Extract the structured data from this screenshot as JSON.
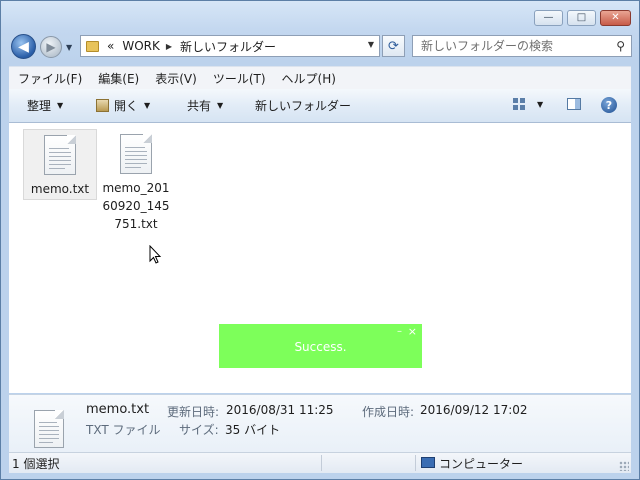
{
  "window": {
    "caption_buttons": {
      "minimize": "—",
      "maximize": "□",
      "close": "✕"
    }
  },
  "nav": {
    "back_glyph": "◀",
    "forward_glyph": "▶",
    "address": {
      "overflow": "«",
      "crumbs": [
        "WORK",
        "新しいフォルダー"
      ]
    },
    "search_placeholder": "新しいフォルダーの検索"
  },
  "menubar": [
    "ファイル(F)",
    "編集(E)",
    "表示(V)",
    "ツール(T)",
    "ヘルプ(H)"
  ],
  "toolbar": {
    "organize": "整理",
    "open": "開く",
    "share": "共有",
    "new_folder": "新しいフォルダー"
  },
  "files": [
    {
      "name": "memo.txt",
      "selected": true
    },
    {
      "name": "memo_20160920_145751.txt",
      "selected": false
    }
  ],
  "toast": {
    "message": "Success.",
    "min": "–",
    "close": "×",
    "color": "#7dff5a"
  },
  "details": {
    "name": "memo.txt",
    "type": "TXT ファイル",
    "modified_label": "更新日時:",
    "modified_value": "2016/08/31 11:25",
    "created_label": "作成日時:",
    "created_value": "2016/09/12 17:02",
    "size_label": "サイズ:",
    "size_value": "35 バイト"
  },
  "status": {
    "selection": "1 個選択",
    "location": "コンピューター"
  }
}
